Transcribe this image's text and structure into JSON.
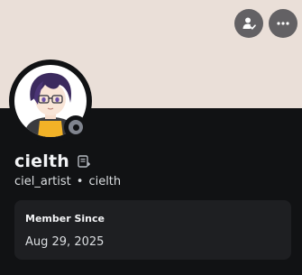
{
  "profile": {
    "banner_color": "#eadfd8",
    "display_name": "cielth",
    "username": "ciel_artist",
    "separator": "•",
    "pronoun_tag": "cielth",
    "status": "offline",
    "status_color": "#80848e"
  },
  "actions": {
    "add_friend_icon": "add-friend-icon",
    "more_icon": "more-icon"
  },
  "member_card": {
    "title": "Member Since",
    "date": "Aug 29, 2025"
  }
}
